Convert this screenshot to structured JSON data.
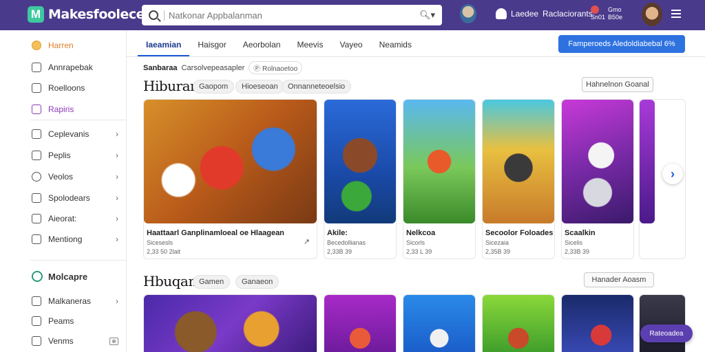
{
  "header": {
    "logo_letter": "M",
    "app_name": "Makesfoolece",
    "search_placeholder": "Natkonar Appbalanman",
    "user_label": "Laedee",
    "account_label": "Raclaciorants",
    "stat_top": "Gmo",
    "stat_left": "Sn01",
    "stat_right": "B50e"
  },
  "sidebar": {
    "items": [
      {
        "label": "Harren"
      },
      {
        "label": "Annrapebak"
      },
      {
        "label": "Roelloons"
      },
      {
        "label": "Rapiris"
      },
      {
        "label": "Ceplevanis"
      },
      {
        "label": "Peplis"
      },
      {
        "label": "Veolos"
      },
      {
        "label": "Spolodears"
      },
      {
        "label": "Aieorat:"
      },
      {
        "label": "Mentiong"
      }
    ],
    "section_heading": "Molcapre",
    "section_items": [
      {
        "label": "Malkaneras"
      },
      {
        "label": "Peams"
      },
      {
        "label": "Venms"
      }
    ]
  },
  "tabs": [
    {
      "label": "Iaeamian"
    },
    {
      "label": "Haisgor"
    },
    {
      "label": "Aeorbolan"
    },
    {
      "label": "Meevis"
    },
    {
      "label": "Vayeo"
    },
    {
      "label": "Neamids"
    }
  ],
  "cta_label": "Famperoeds   Aledoldiabebal 6%",
  "filters": {
    "label": "Sanbaraa",
    "sub": "Carsolvepeasapler",
    "chip": "Rolnaoetoo"
  },
  "section1": {
    "title": "Hiburan",
    "chips": [
      "Gaopom",
      "Hioeseoan",
      "Onnanneteoelsio"
    ],
    "button": "Hahnelnon Goanal",
    "cards": [
      {
        "title": "Haattaarl Ganplinamloeal oe Hlaagean",
        "sub": "Sicesesls",
        "meta": "2,33 50 2lait"
      },
      {
        "title": "Akile:",
        "sub": "Becedollianas",
        "meta": "2,33B 39"
      },
      {
        "title": "Nelkcoa",
        "sub": "Sicorls",
        "meta": "2,33 L 39"
      },
      {
        "title": "Secoolor Foloades",
        "sub": "Sicezaia",
        "meta": "2,35B 39"
      },
      {
        "title": "Scaalkin",
        "sub": "Sicelis",
        "meta": "2,33B 39"
      }
    ]
  },
  "section2": {
    "title": "Hbuqan",
    "chips": [
      "Gamen",
      "Ganaeon"
    ],
    "button": "Hanader Aoasm"
  },
  "float_label": "Rateoadea"
}
